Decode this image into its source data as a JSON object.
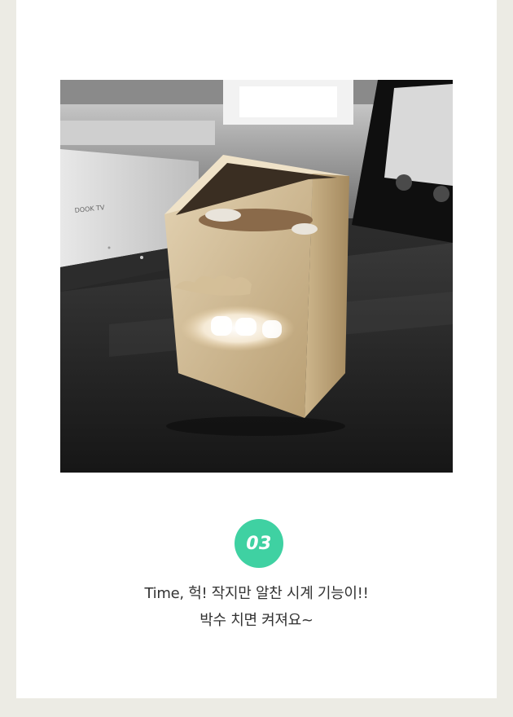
{
  "photo": {
    "alt": "3D printed pen holder with light-up clock display",
    "tv_label": "DOOK TV"
  },
  "step": {
    "number": "03"
  },
  "caption": {
    "line1": "Time, 헉! 작지만 알찬 시계 기능이!!",
    "line2": "박수 치면 켜져요~"
  },
  "colors": {
    "page_background": "#ecebe4",
    "card_background": "#ffffff",
    "badge": "#3fd1a2",
    "badge_text": "#ffffff",
    "caption_text": "#333333"
  }
}
